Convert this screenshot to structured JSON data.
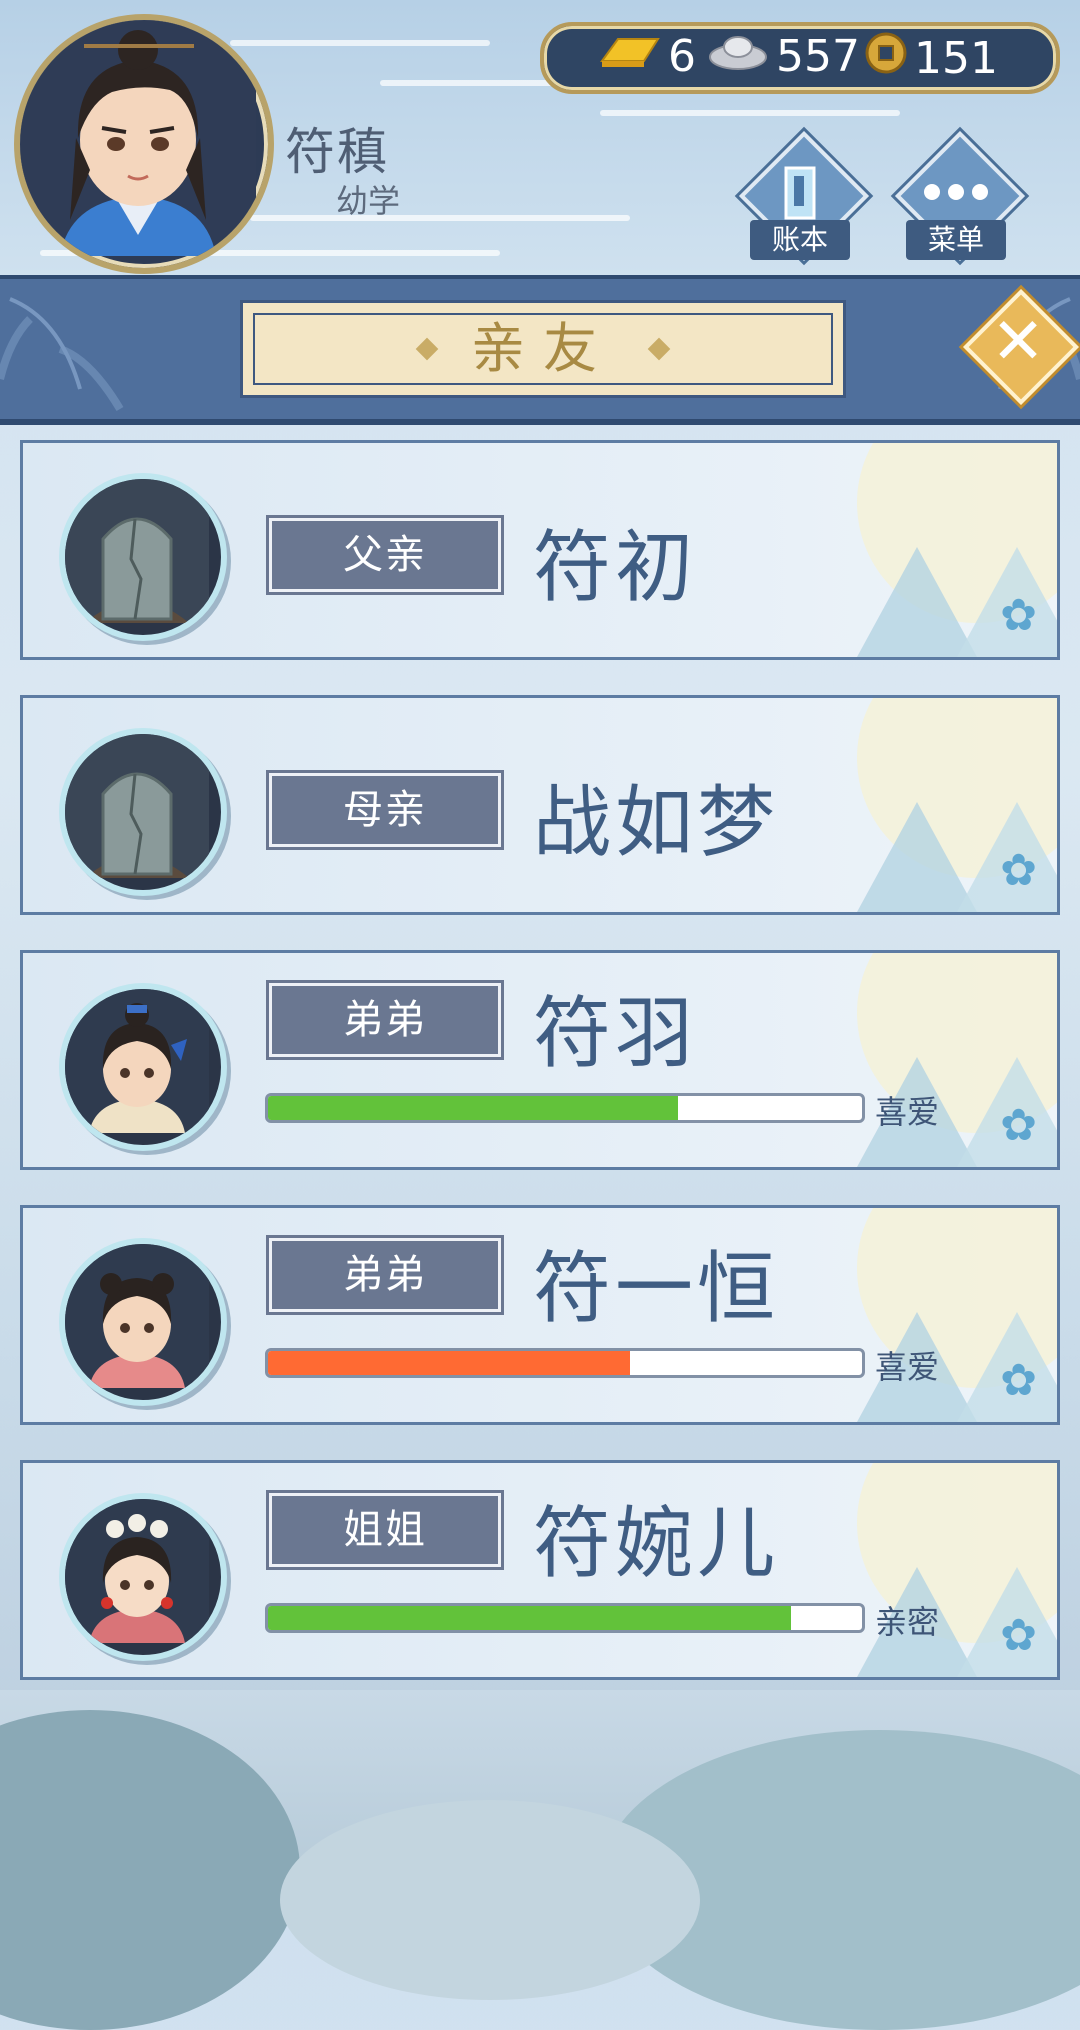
{
  "player": {
    "name": "符稹",
    "rank": "幼学"
  },
  "currency": {
    "gold": "6",
    "silver": "557",
    "coin": "151"
  },
  "header_buttons": {
    "ledger_label": "账本",
    "menu_label": "菜单"
  },
  "title": "亲友",
  "relatives": [
    {
      "relation": "父亲",
      "name": "符初",
      "deceased": true
    },
    {
      "relation": "母亲",
      "name": "战如梦",
      "deceased": true
    },
    {
      "relation": "弟弟",
      "name": "符羽",
      "affinity": 0.69,
      "affinity_color": "#62c23a",
      "affinity_label": "喜爱"
    },
    {
      "relation": "弟弟",
      "name": "符一恒",
      "affinity": 0.61,
      "affinity_color": "#ff6a33",
      "affinity_label": "喜爱"
    },
    {
      "relation": "姐姐",
      "name": "符婉儿",
      "affinity": 0.88,
      "affinity_color": "#62c23a",
      "affinity_label": "亲密"
    }
  ],
  "colors": {
    "accent_blue": "#4f6f9c",
    "gold_border": "#b69a5a"
  }
}
